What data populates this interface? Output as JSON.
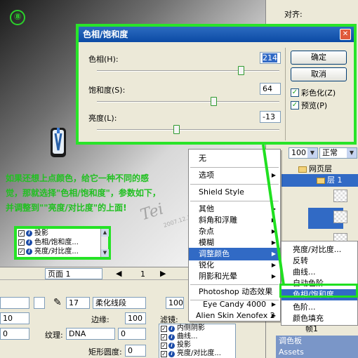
{
  "step": "⑧",
  "tutorial": {
    "line1": "如果还想上点颜色，给它一种不同的感",
    "line2": "觉，那就选择\"色相/饱和度\"，参数如下，",
    "line3": "并调整到\"\"亮度/对比度\"的上面!"
  },
  "watermark": "Tei",
  "watermark_date": "2007.12.18",
  "mini_filters": [
    "投影",
    "色相/饱和度...",
    "亮度/对比度..."
  ],
  "dialog": {
    "title": "色相/饱和度",
    "hue_label": "色相(H):",
    "hue_value": "214",
    "hue_level": 0.79,
    "sat_label": "饱和度(S):",
    "sat_value": "64",
    "sat_level": 0.64,
    "light_label": "亮度(L):",
    "light_value": "-13",
    "light_level": 0.435,
    "ok_label": "确定",
    "cancel_label": "取消",
    "colorize_label": "彩色化(Z)",
    "colorize_checked": true,
    "preview_label": "预览(P)",
    "preview_checked": true
  },
  "context_menu": {
    "items": [
      "无",
      "选项",
      "Shield Style",
      "其他",
      "斜角和浮雕",
      "杂点",
      "模糊",
      "调整颜色",
      "锐化",
      "阴影和光晕",
      "Photoshop 动态效果",
      "Eye Candy 4000",
      "Alien Skin Xenofex 2"
    ],
    "highlighted": "调整颜色"
  },
  "sub_menu": {
    "items": [
      "亮度/对比度...",
      "反转",
      "曲线...",
      "自动色阶",
      "色相/饱和度...",
      "色阶...",
      "颜色填充"
    ],
    "highlighted": "色相/饱和度..."
  },
  "right_panel": {
    "align_label": "对齐:",
    "opacity": "100",
    "blend": "正常",
    "layers": [
      "网页层",
      "层 1"
    ],
    "frame_label": "帧1",
    "sections": [
      "调色板",
      "Assets"
    ]
  },
  "props": {
    "page_label": "页面 1",
    "page_num": "1",
    "brush_size": "17",
    "edge_type": "柔化线段",
    "edge_label": "边缘:",
    "edge_value": "100",
    "texture_label": "纹理:",
    "texture_value": "DNA",
    "texture_amount": "0",
    "roundness_label": "矩形圆度:",
    "roundness_value": "0",
    "filter_label": "滤镜:",
    "opacity": "100",
    "left_values": [
      "",
      "10",
      "0"
    ],
    "filters": [
      "内侧阴影",
      "曲线...",
      "投影",
      "亮度/对比度..."
    ]
  }
}
